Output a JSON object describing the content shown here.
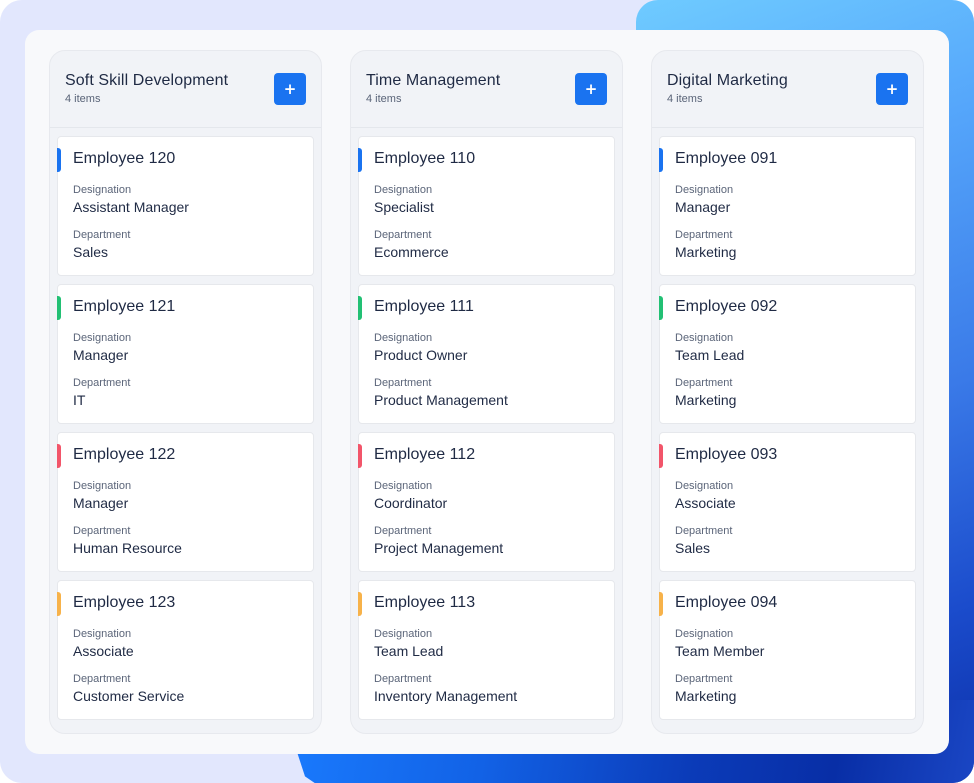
{
  "colors": {
    "accent_blue": "#1a73f0",
    "accent_green": "#22c074",
    "accent_red": "#f2556a",
    "accent_orange": "#f7b24a"
  },
  "labels": {
    "designation": "Designation",
    "department": "Department",
    "add_icon": "+"
  },
  "columns": [
    {
      "title": "Soft Skill Development",
      "count": "4 items",
      "cards": [
        {
          "name": "Employee 120",
          "designation": "Assistant Manager",
          "department": "Sales",
          "accent": "blue"
        },
        {
          "name": "Employee 121",
          "designation": "Manager",
          "department": "IT",
          "accent": "green"
        },
        {
          "name": "Employee 122",
          "designation": "Manager",
          "department": "Human Resource",
          "accent": "red"
        },
        {
          "name": "Employee 123",
          "designation": "Associate",
          "department": "Customer Service",
          "accent": "orange"
        }
      ]
    },
    {
      "title": "Time Management",
      "count": "4 items",
      "cards": [
        {
          "name": "Employee 110",
          "designation": "Specialist",
          "department": "Ecommerce",
          "accent": "blue"
        },
        {
          "name": "Employee 111",
          "designation": "Product Owner",
          "department": "Product Management",
          "accent": "green"
        },
        {
          "name": "Employee 112",
          "designation": "Coordinator",
          "department": "Project Management",
          "accent": "red"
        },
        {
          "name": "Employee 113",
          "designation": "Team Lead",
          "department": "Inventory Management",
          "accent": "orange"
        }
      ]
    },
    {
      "title": "Digital Marketing",
      "count": "4 items",
      "cards": [
        {
          "name": "Employee 091",
          "designation": "Manager",
          "department": "Marketing",
          "accent": "blue"
        },
        {
          "name": "Employee 092",
          "designation": "Team Lead",
          "department": "Marketing",
          "accent": "green"
        },
        {
          "name": "Employee 093",
          "designation": "Associate",
          "department": "Sales",
          "accent": "red"
        },
        {
          "name": "Employee 094",
          "designation": "Team Member",
          "department": "Marketing",
          "accent": "orange"
        }
      ]
    }
  ]
}
